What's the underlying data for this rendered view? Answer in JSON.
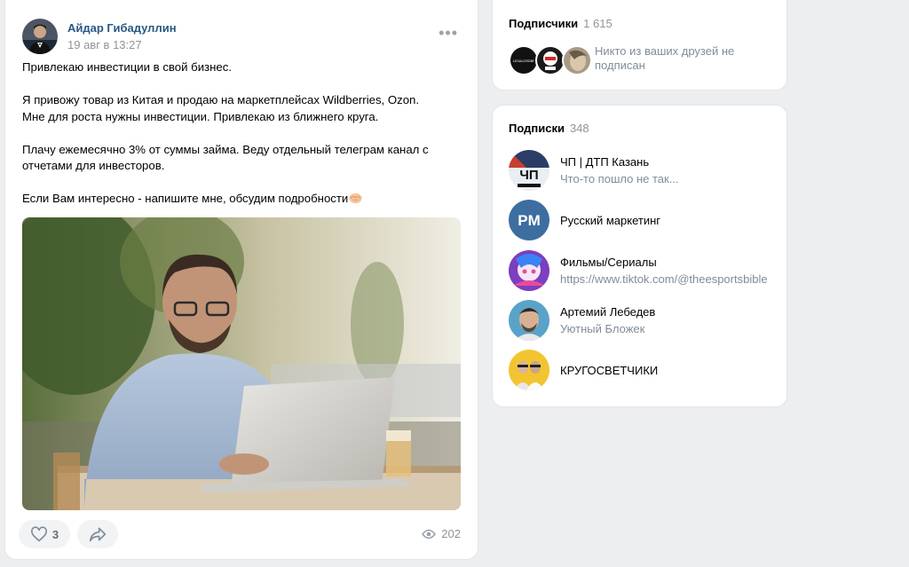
{
  "post": {
    "author": "Айдар Гибадуллин",
    "date": "19 авг в 13:27",
    "more_icon": "ellipsis-icon",
    "paragraphs": [
      "Привлекаю инвестиции в свой бизнес.",
      "Я привожу товар из Китая и продаю на маркетплейсах Wildberries, Ozon.\nМне для роста нужны инвестиции. Привлекаю из ближнего круга.",
      "Плачу ежемесячно 3% от суммы займа. Веду отдельный телеграм канал с отчетами для инвесторов.",
      "Если Вам интересно - напишите мне, обсудим подробности"
    ],
    "likes": "3",
    "views": "202",
    "icons": {
      "like": "heart-icon",
      "share": "share-arrow-icon",
      "views": "eye-icon",
      "emoji": "handshake-emoji"
    }
  },
  "followers": {
    "title": "Подписчики",
    "count": "1 615",
    "note": "Никто из ваших друзей не подписан",
    "first_avatar_text": "LEGALIZEDBY"
  },
  "subscriptions": {
    "title": "Подписки",
    "count": "348",
    "items": [
      {
        "name": "ЧП | ДТП Казань",
        "desc": "Что-то пошло не так...",
        "avatar_text": "ЧП"
      },
      {
        "name": "Русский маркетинг",
        "desc": "",
        "avatar_text": "PM"
      },
      {
        "name": "Фильмы/Сериалы",
        "desc": "https://www.tiktok.com/@theesportsbible",
        "avatar_text": ""
      },
      {
        "name": "Артемий Лебедев",
        "desc": "Уютный Бложек",
        "avatar_text": ""
      },
      {
        "name": "КРУГОСВЕТЧИКИ",
        "desc": "",
        "avatar_text": ""
      }
    ]
  },
  "colors": {
    "page_bg": "#edeef0",
    "link": "#2a5885",
    "secondary_text": "#818c99",
    "rm_blue": "#3d6ea0"
  }
}
